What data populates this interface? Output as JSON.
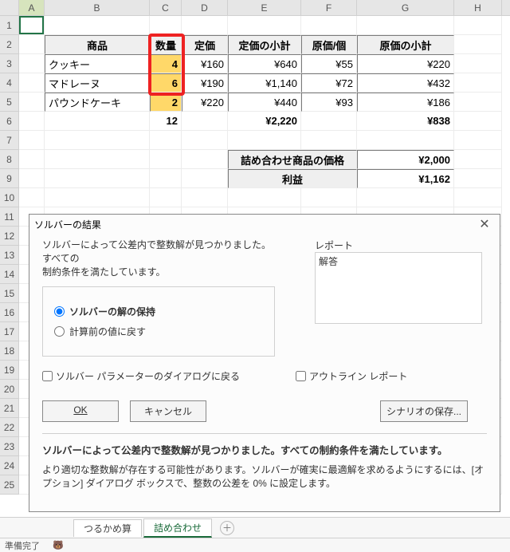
{
  "cols": {
    "A": "A",
    "B": "B",
    "C": "C",
    "D": "D",
    "E": "E",
    "F": "F",
    "G": "G",
    "H": "H"
  },
  "rows": [
    "1",
    "2",
    "3",
    "4",
    "5",
    "6",
    "7",
    "8",
    "9",
    "10",
    "11",
    "12",
    "13",
    "14",
    "15",
    "16",
    "17",
    "18",
    "19",
    "20",
    "21",
    "22",
    "23",
    "24",
    "25"
  ],
  "hdr": {
    "B": "商品",
    "C": "数量",
    "D": "定価",
    "E": "定価の小計",
    "F": "原価/個",
    "G": "原価の小計"
  },
  "data": [
    {
      "B": "クッキー",
      "C": "4",
      "D": "¥160",
      "E": "¥640",
      "F": "¥55",
      "G": "¥220"
    },
    {
      "B": "マドレーヌ",
      "C": "6",
      "D": "¥190",
      "E": "¥1,140",
      "F": "¥72",
      "G": "¥432"
    },
    {
      "B": "パウンドケーキ",
      "C": "2",
      "D": "¥220",
      "E": "¥440",
      "F": "¥93",
      "G": "¥186"
    }
  ],
  "totals": {
    "C": "12",
    "E": "¥2,220",
    "G": "¥838"
  },
  "summary": {
    "label1": "詰め合わせ商品の価格",
    "val1": "¥2,000",
    "label2": "利益",
    "val2": "¥1,162"
  },
  "tabs": {
    "t1": "つるかめ算",
    "t2": "詰め合わせ"
  },
  "status": {
    "s1": "準備完了",
    "s2": "🐻"
  },
  "dlg": {
    "title": "ソルバーの結果",
    "msg1": "ソルバーによって公差内で整数解が見つかりました。すべての",
    "msg2": "制約条件を満たしています。",
    "reportsLbl": "レポート",
    "reportItem": "解答",
    "radio1": "ソルバーの解の保持",
    "radio2": "計算前の値に戻す",
    "chk1": "ソルバー パラメーターのダイアログに戻る",
    "chk2": "アウトライン レポート",
    "ok": "OK",
    "cancel": "キャンセル",
    "save": "シナリオの保存...",
    "summary": "ソルバーによって公差内で整数解が見つかりました。すべての制約条件を満たしています。",
    "detail": "より適切な整数解が存在する可能性があります。ソルバーが確実に最適解を求めるようにするには、[オプション] ダイアログ ボックスで、整数の公差を 0% に設定します。"
  }
}
